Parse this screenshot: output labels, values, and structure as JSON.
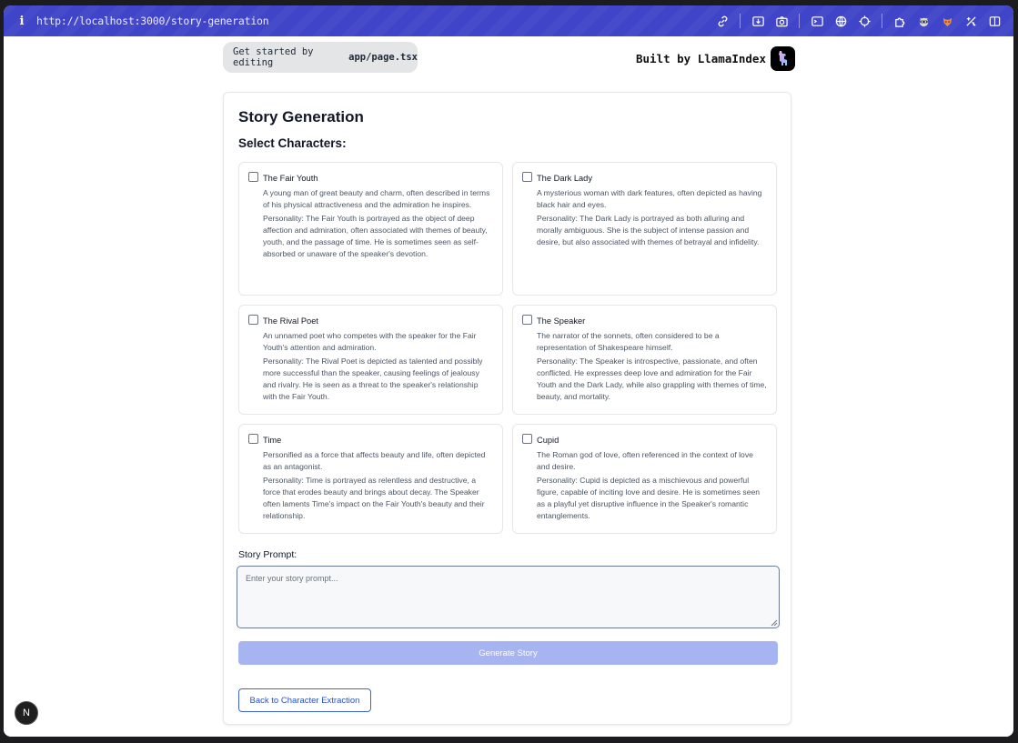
{
  "browser": {
    "url": "http://localhost:3000/story-generation",
    "info_glyph": "i"
  },
  "header": {
    "get_started_prefix": "Get started by editing",
    "get_started_file": "app/page.tsx",
    "built_by": "Built by LlamaIndex"
  },
  "page": {
    "title": "Story Generation",
    "select_characters_label": "Select Characters:",
    "characters": [
      {
        "name": "The Fair Youth",
        "description": "A young man of great beauty and charm, often described in terms of his physical attractiveness and the admiration he inspires.",
        "personality": "Personality: The Fair Youth is portrayed as the object of deep affection and admiration, often associated with themes of beauty, youth, and the passage of time. He is sometimes seen as self-absorbed or unaware of the speaker's devotion.",
        "checked": false
      },
      {
        "name": "The Dark Lady",
        "description": "A mysterious woman with dark features, often depicted as having black hair and eyes.",
        "personality": "Personality: The Dark Lady is portrayed as both alluring and morally ambiguous. She is the subject of intense passion and desire, but also associated with themes of betrayal and infidelity.",
        "checked": false
      },
      {
        "name": "The Rival Poet",
        "description": "An unnamed poet who competes with the speaker for the Fair Youth's attention and admiration.",
        "personality": "Personality: The Rival Poet is depicted as talented and possibly more successful than the speaker, causing feelings of jealousy and rivalry. He is seen as a threat to the speaker's relationship with the Fair Youth.",
        "checked": false
      },
      {
        "name": "The Speaker",
        "description": "The narrator of the sonnets, often considered to be a representation of Shakespeare himself.",
        "personality": "Personality: The Speaker is introspective, passionate, and often conflicted. He expresses deep love and admiration for the Fair Youth and the Dark Lady, while also grappling with themes of time, beauty, and mortality.",
        "checked": false
      },
      {
        "name": "Time",
        "description": "Personified as a force that affects beauty and life, often depicted as an antagonist.",
        "personality": "Personality: Time is portrayed as relentless and destructive, a force that erodes beauty and brings about decay. The Speaker often laments Time's impact on the Fair Youth's beauty and their relationship.",
        "checked": false
      },
      {
        "name": "Cupid",
        "description": "The Roman god of love, often referenced in the context of love and desire.",
        "personality": "Personality: Cupid is depicted as a mischievous and powerful figure, capable of inciting love and desire. He is sometimes seen as a playful yet disruptive influence in the Speaker's romantic entanglements.",
        "checked": false
      }
    ],
    "story_prompt_label": "Story Prompt:",
    "story_prompt_value": "",
    "story_prompt_placeholder": "Enter your story prompt...",
    "generate_button": "Generate Story",
    "back_button": "Back to Character Extraction"
  },
  "dev_badge": "N",
  "toolbar_icons": [
    "link-icon",
    "install-icon",
    "camera-icon",
    "terminal-icon",
    "globe-icon",
    "target-icon",
    "puzzle-icon",
    "raccoon-extension-icon",
    "fox-extension-icon",
    "extension-icon",
    "sidebar-icon"
  ],
  "colors": {
    "browser_bar": "#3f44c8",
    "generate_button": "#a6b4f2",
    "back_button_border": "#3b63d9"
  }
}
